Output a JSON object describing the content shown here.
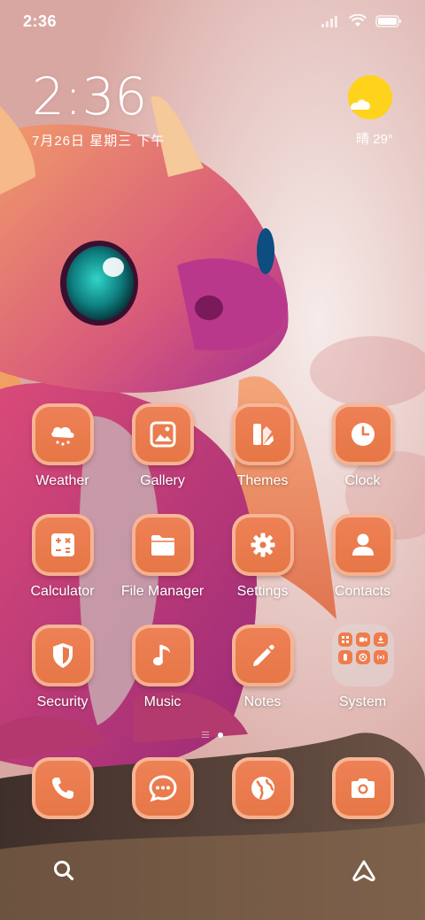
{
  "status_bar": {
    "time": "2:36",
    "icons": [
      "signal-icon",
      "wifi-icon",
      "battery-icon"
    ]
  },
  "clock_widget": {
    "time": "2:36",
    "date": "7月26日 星期三 下午"
  },
  "weather_widget": {
    "icon": "sun-cloud-icon",
    "temperature": "晴 29°"
  },
  "apps": [
    {
      "label": "Weather",
      "icon": "weather-icon"
    },
    {
      "label": "Gallery",
      "icon": "gallery-icon"
    },
    {
      "label": "Themes",
      "icon": "themes-icon"
    },
    {
      "label": "Clock",
      "icon": "clock-icon"
    },
    {
      "label": "Calculator",
      "icon": "calculator-icon"
    },
    {
      "label": "File Manager",
      "icon": "folder-icon"
    },
    {
      "label": "Settings",
      "icon": "gear-icon"
    },
    {
      "label": "Contacts",
      "icon": "person-icon"
    },
    {
      "label": "Security",
      "icon": "shield-icon"
    },
    {
      "label": "Music",
      "icon": "music-note-icon"
    },
    {
      "label": "Notes",
      "icon": "pencil-icon"
    },
    {
      "label": "System",
      "icon": "folder-grid-icon"
    }
  ],
  "dock": [
    {
      "icon": "phone-icon",
      "label": ""
    },
    {
      "icon": "message-icon",
      "label": ""
    },
    {
      "icon": "browser-globe-icon",
      "label": ""
    },
    {
      "icon": "camera-icon",
      "label": ""
    }
  ],
  "page_indicator": {
    "pages": 2,
    "current": 2
  },
  "bottom_bar": {
    "left_icon": "search-icon",
    "right_icon": "assistant-icon"
  },
  "colors": {
    "app_icon": "#e97a4b",
    "app_icon_rim": "#ffdcc8",
    "weather_sun": "#ffd21c",
    "label_text": "#ffffff"
  }
}
